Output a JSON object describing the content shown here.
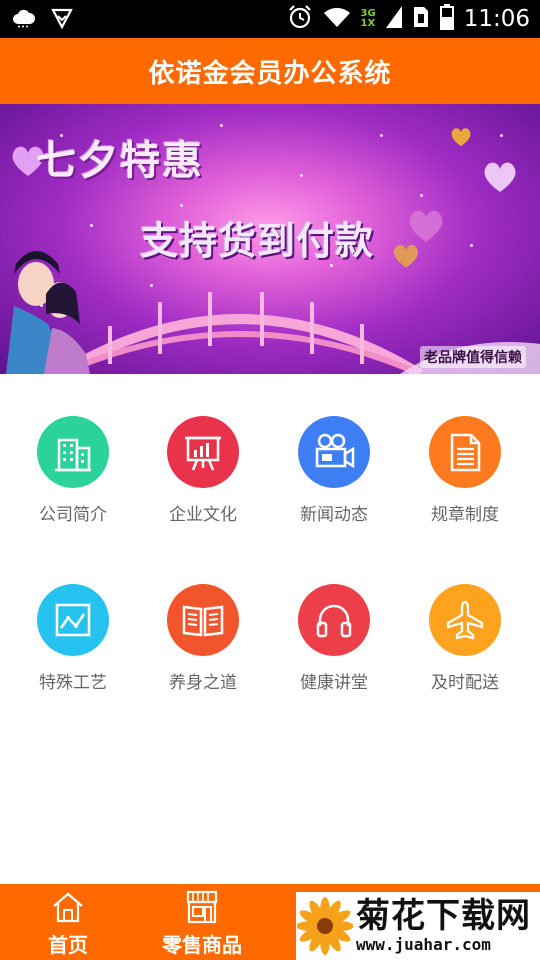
{
  "status_bar": {
    "time": "11:06",
    "network_top": "3G",
    "network_bottom": "1X",
    "icons": [
      "cloud-icon",
      "vpn-shield-icon",
      "alarm-icon",
      "wifi-icon",
      "signal-icon",
      "sim-icon",
      "battery-icon"
    ]
  },
  "header": {
    "title": "依诺金会员办公系统"
  },
  "banner": {
    "title": "七夕特惠",
    "subtitle": "支持货到付款",
    "slogan": "老品牌值得信赖"
  },
  "grid": {
    "items": [
      {
        "label": "公司简介",
        "icon": "building-icon",
        "color": "#2bd39a"
      },
      {
        "label": "企业文化",
        "icon": "presentation-board-icon",
        "color": "#e8334a"
      },
      {
        "label": "新闻动态",
        "icon": "video-camera-icon",
        "color": "#3f7ff5"
      },
      {
        "label": "规章制度",
        "icon": "document-icon",
        "color": "#ff7a1e"
      },
      {
        "label": "特殊工艺",
        "icon": "line-chart-icon",
        "color": "#27c3f0"
      },
      {
        "label": "养身之道",
        "icon": "open-book-icon",
        "color": "#f2552c"
      },
      {
        "label": "健康讲堂",
        "icon": "headphones-icon",
        "color": "#ec3f4a"
      },
      {
        "label": "及时配送",
        "icon": "airplane-icon",
        "color": "#ffa31f"
      }
    ]
  },
  "bottom_nav": {
    "tabs": [
      {
        "label": "首页",
        "icon": "home-icon"
      },
      {
        "label": "零售商品",
        "icon": "store-icon"
      }
    ]
  },
  "watermark": {
    "brand": "菊花下载网",
    "url": "www.juahar.com"
  },
  "colors": {
    "accent": "#ff6a00",
    "label_gray": "#666666"
  }
}
